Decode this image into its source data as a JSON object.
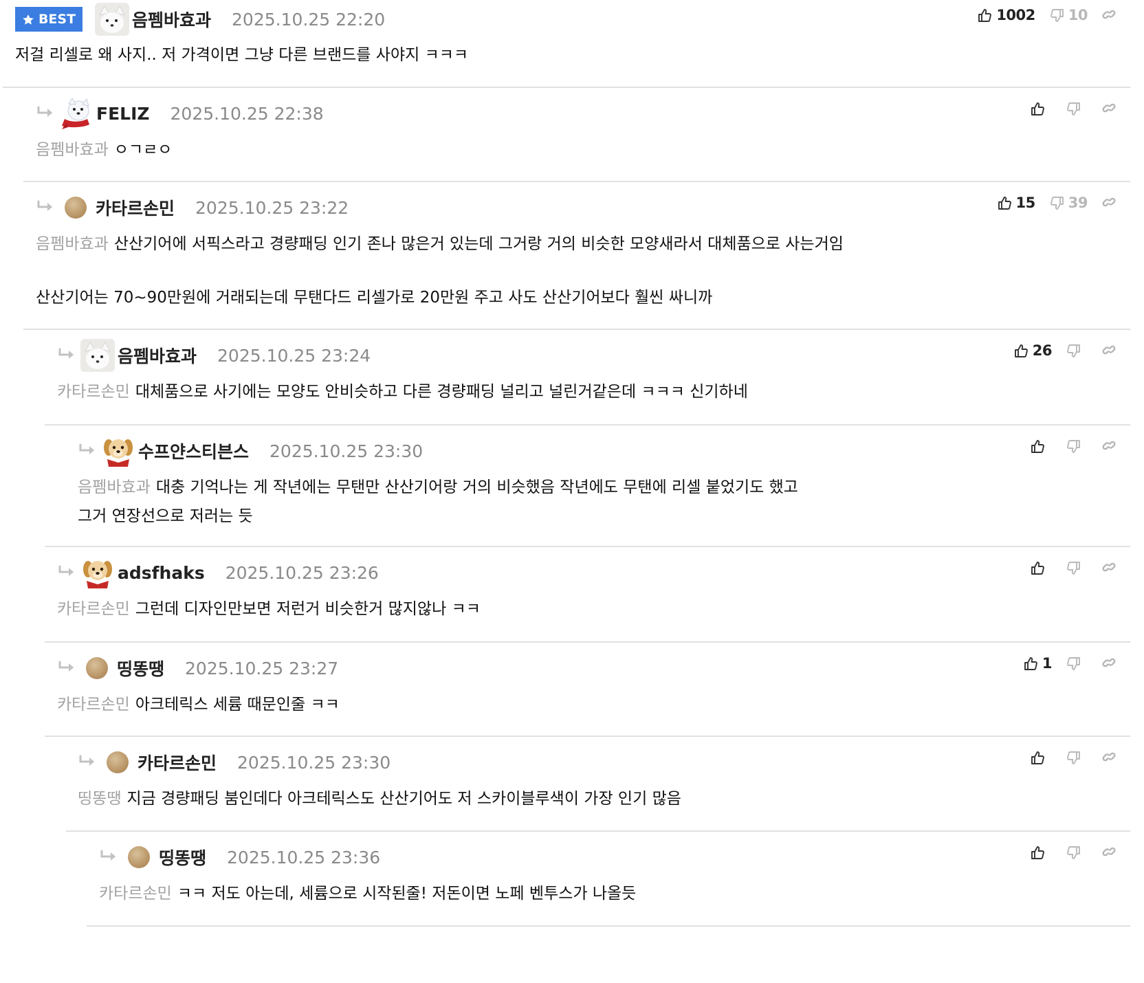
{
  "best_badge": {
    "label": "BEST",
    "color": "#3b7de0"
  },
  "reply_arrow_icon": "reply-arrow-icon",
  "comments": [
    {
      "nickname": "음펨바효과",
      "timestamp": "2025.10.25 22:20",
      "avatar": "white-fox-avatar",
      "mention": "",
      "lines": [
        "저걸 리셀로 왜 사지.. 저 가격이면 그냥 다른 브랜드를 사야지 ㅋㅋㅋ"
      ],
      "upvotes": "1002",
      "downvotes": "10"
    },
    {
      "nickname": "FELIZ",
      "timestamp": "2025.10.25 22:38",
      "avatar": "white-dog-scarf-avatar",
      "mention": "음펨바효과",
      "lines": [
        "ㅇㄱㄹㅇ"
      ],
      "upvotes": "",
      "downvotes": ""
    },
    {
      "nickname": "카타르손민",
      "timestamp": "2025.10.25 23:22",
      "avatar": "beige-circle-avatar",
      "mention": "음펨바효과",
      "lines": [
        "산산기어에 서픽스라고 경량패딩 인기 존나 많은거 있는데 그거랑 거의 비슷한 모양새라서 대체품으로 사는거임",
        "",
        "산산기어는 70~90만원에 거래되는데 무탠다드 리셀가로 20만원 주고 사도 산산기어보다 훨씬 싸니까"
      ],
      "upvotes": "15",
      "downvotes": "39"
    },
    {
      "nickname": "음펨바효과",
      "timestamp": "2025.10.25 23:24",
      "avatar": "white-fox-avatar",
      "mention": "카타르손민",
      "lines": [
        "대체품으로 사기에는 모양도 안비슷하고 다른 경량패딩 널리고 널린거같은데 ㅋㅋㅋ 신기하네"
      ],
      "upvotes": "26",
      "downvotes": ""
    },
    {
      "nickname": "수프얀스티븐스",
      "timestamp": "2025.10.25 23:30",
      "avatar": "puppy-avatar",
      "mention": "음펨바효과",
      "lines": [
        "대충 기억나는 게 작년에는 무탠만 산산기어랑 거의 비슷했음 작년에도 무탠에 리셀 붙었기도 했고",
        "그거 연장선으로 저러는 듯"
      ],
      "upvotes": "",
      "downvotes": ""
    },
    {
      "nickname": "adsfhaks",
      "timestamp": "2025.10.25 23:26",
      "avatar": "puppy-avatar",
      "mention": "카타르손민",
      "lines": [
        "그런데 디자인만보면 저런거 비슷한거 많지않나 ㅋㅋ"
      ],
      "upvotes": "",
      "downvotes": ""
    },
    {
      "nickname": "띵똥땡",
      "timestamp": "2025.10.25 23:27",
      "avatar": "beige-circle-avatar",
      "mention": "카타르손민",
      "lines": [
        "아크테릭스 세륨 때문인줄 ㅋㅋ"
      ],
      "upvotes": "1",
      "downvotes": ""
    },
    {
      "nickname": "카타르손민",
      "timestamp": "2025.10.25 23:30",
      "avatar": "beige-circle-avatar",
      "mention": "띵똥땡",
      "lines": [
        "지금 경량패딩 붐인데다 아크테릭스도 산산기어도 저 스카이블루색이 가장 인기 많음"
      ],
      "upvotes": "",
      "downvotes": ""
    },
    {
      "nickname": "띵똥땡",
      "timestamp": "2025.10.25 23:36",
      "avatar": "beige-circle-avatar",
      "mention": "카타르손민",
      "lines": [
        "ㅋㅋ 저도 아는데, 세륨으로 시작된줄! 저돈이면 노페 벤투스가 나올듯"
      ],
      "upvotes": "",
      "downvotes": ""
    }
  ]
}
